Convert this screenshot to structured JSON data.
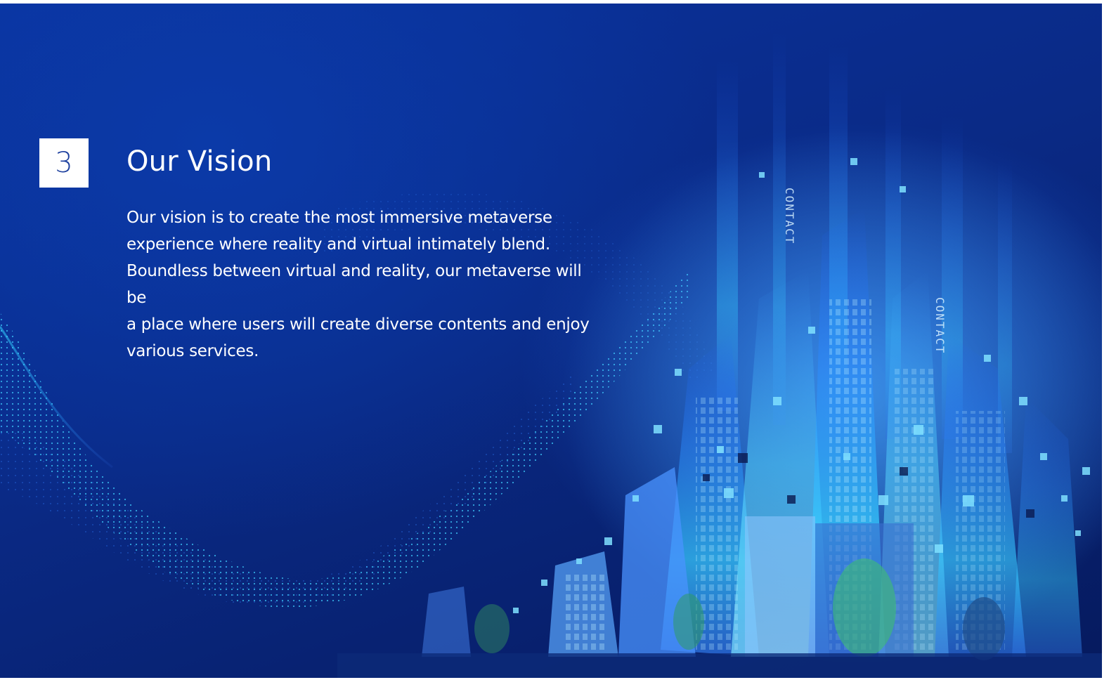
{
  "slide": {
    "section_number": "3",
    "title": "Our Vision",
    "body_lines": [
      "Our vision is to create the most immersive metaverse",
      "experience where reality and virtual intimately blend.",
      "Boundless between virtual and reality, our metaverse will be",
      "a place where users will create diverse contents and enjoy",
      "various services."
    ],
    "sign_text_left": "CONTACT",
    "sign_text_right": "CONTACT"
  },
  "colors": {
    "background_dark": "#061a5e",
    "background_mid": "#0a2a86",
    "accent_cyan": "#33d6ff",
    "number_text": "#1c3f9e",
    "text": "#ffffff"
  },
  "icons": {
    "illustration": "digital-city-illustration",
    "wave": "dotted-wave-graphic"
  }
}
